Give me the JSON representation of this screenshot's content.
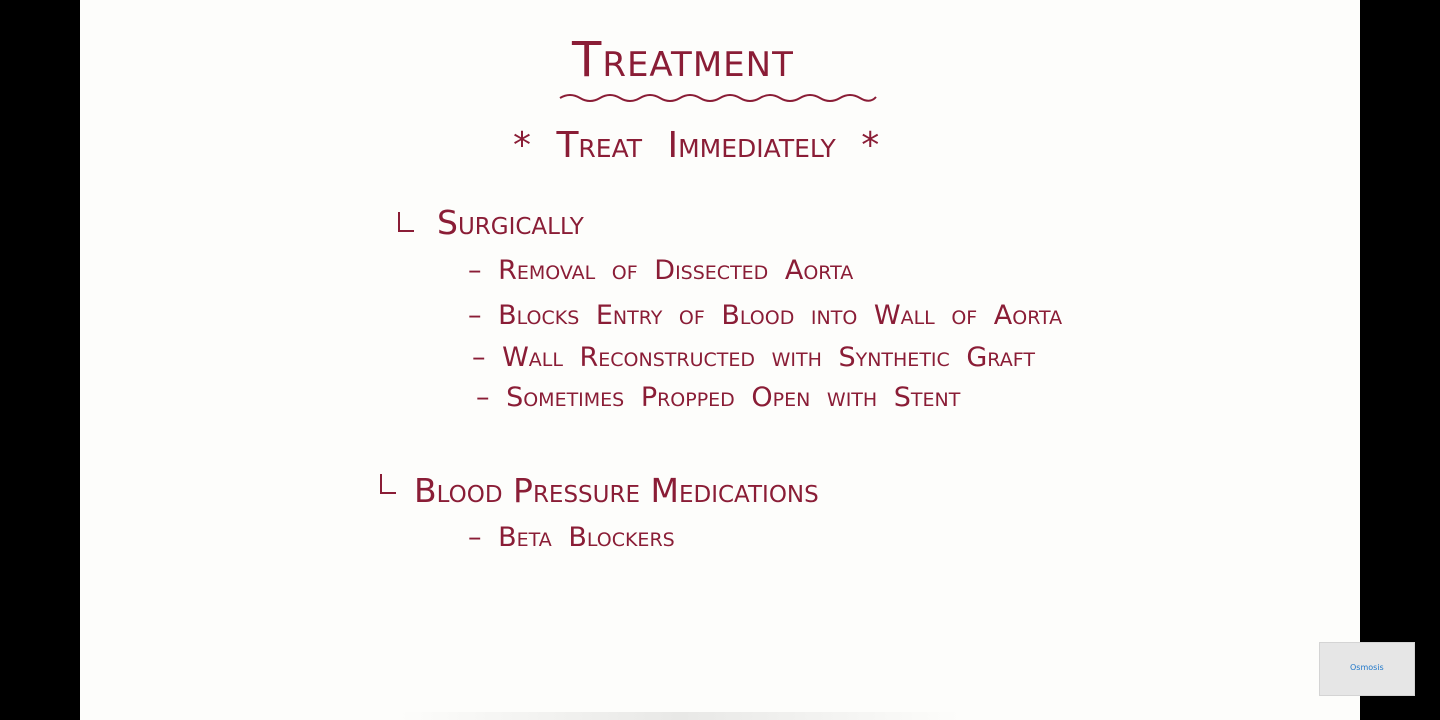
{
  "slide": {
    "title": "Treatment",
    "headline": "* Treat Immediately *",
    "sections": [
      {
        "heading": "Surgically",
        "items": [
          "– Removal of Dissected Aorta",
          "– Blocks Entry of Blood into Wall of Aorta",
          "– Wall Reconstructed with Synthetic Graft",
          "– Sometimes Propped Open with Stent"
        ]
      },
      {
        "heading": "Blood Pressure Medications",
        "items": [
          "– Beta Blockers"
        ]
      }
    ]
  },
  "watermark": {
    "text": "Osmosis"
  },
  "colors": {
    "ink": "#8a1d36",
    "board": "#fdfdfb",
    "letterbox": "#000000",
    "logo": "#1f77c9"
  }
}
